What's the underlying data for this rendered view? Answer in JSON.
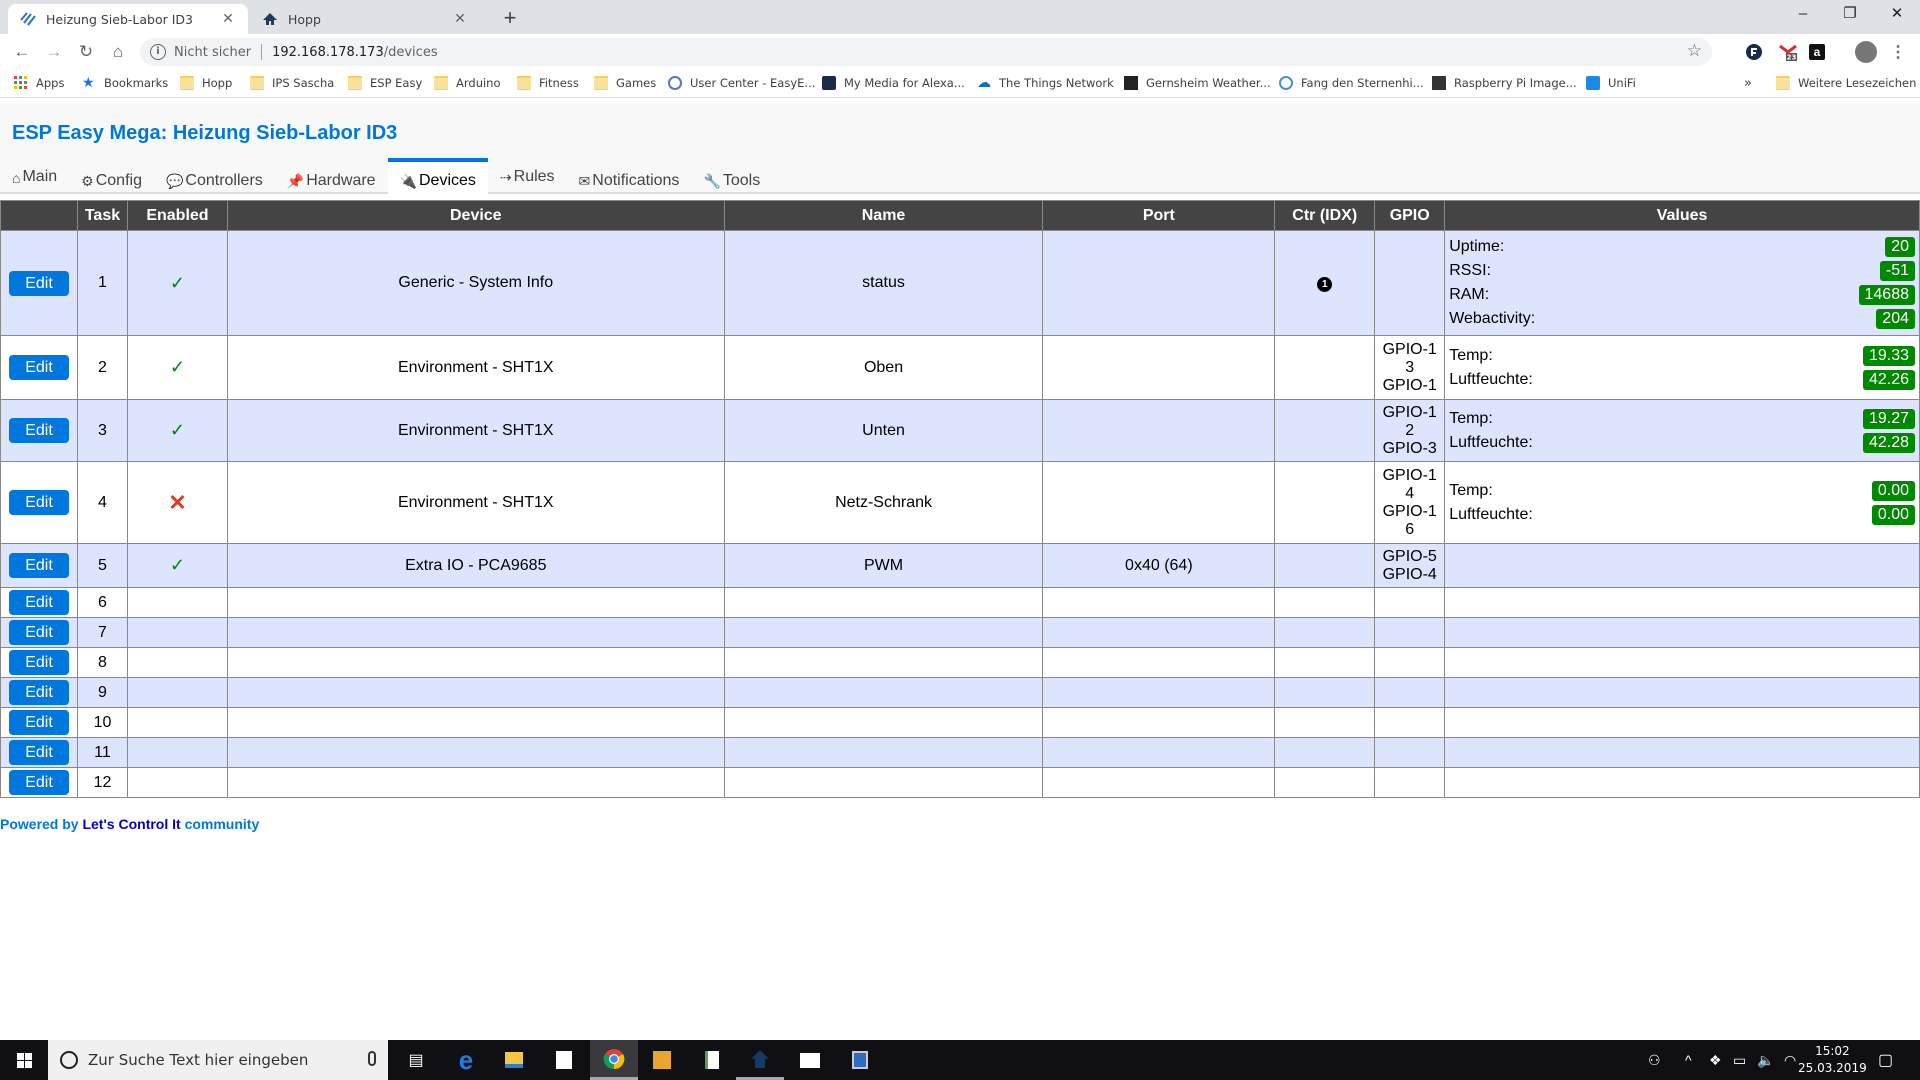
{
  "browser": {
    "tabs": [
      {
        "title": "Heizung Sieb-Labor ID3",
        "icon": "espeasy-icon",
        "active": true
      },
      {
        "title": "Hopp",
        "icon": "home-icon",
        "active": false
      }
    ],
    "new_tab": "+",
    "window_controls": {
      "minimize": "–",
      "maximize": "❐",
      "close": "✕"
    },
    "omnibox": {
      "security_label": "Nicht sicher",
      "host": "192.168.178.173",
      "path": "/devices"
    },
    "extensions": [
      {
        "name": "privacy-extension-icon"
      },
      {
        "name": "gmail-icon",
        "badge": "23"
      },
      {
        "name": "amazon-icon",
        "label": "a"
      }
    ],
    "bookmarks": [
      {
        "label": "Apps",
        "icon": "apps-grid-icon"
      },
      {
        "label": "Bookmarks",
        "icon": "star-icon"
      },
      {
        "label": "Hopp",
        "icon": "folder-icon"
      },
      {
        "label": "IPS Sascha",
        "icon": "folder-icon"
      },
      {
        "label": "ESP Easy",
        "icon": "folder-icon"
      },
      {
        "label": "Arduino",
        "icon": "folder-icon"
      },
      {
        "label": "Fitness",
        "icon": "folder-icon"
      },
      {
        "label": "Games",
        "icon": "folder-icon"
      },
      {
        "label": "User Center - EasyE...",
        "icon": "site-icon"
      },
      {
        "label": "My Media for Alexa...",
        "icon": "site-icon"
      },
      {
        "label": "The Things Network",
        "icon": "cloud-icon"
      },
      {
        "label": "Gernsheim Weather...",
        "icon": "site-icon"
      },
      {
        "label": "Fang den Sternenhi...",
        "icon": "site-icon"
      },
      {
        "label": "Raspberry Pi Image...",
        "icon": "site-icon"
      },
      {
        "label": "UniFi",
        "icon": "unifi-icon"
      }
    ],
    "bookmarks_overflow": "»",
    "other_bookmarks": "Weitere Lesezeichen"
  },
  "page": {
    "title": "ESP Easy Mega: Heizung Sieb-Labor ID3",
    "menu": [
      {
        "label": "Main",
        "icon": "⌂",
        "active": false
      },
      {
        "label": "Config",
        "icon": "⚙",
        "active": false
      },
      {
        "label": "Controllers",
        "icon": "💬",
        "active": false
      },
      {
        "label": "Hardware",
        "icon": "📌",
        "active": false
      },
      {
        "label": "Devices",
        "icon": "🔌",
        "active": true
      },
      {
        "label": "Rules",
        "icon": "⇢",
        "active": false
      },
      {
        "label": "Notifications",
        "icon": "✉",
        "active": false
      },
      {
        "label": "Tools",
        "icon": "🔧",
        "active": false
      }
    ],
    "table": {
      "headers": [
        "",
        "Task",
        "Enabled",
        "Device",
        "Name",
        "Port",
        "Ctr (IDX)",
        "GPIO",
        "Values"
      ],
      "edit_label": "Edit",
      "rows": [
        {
          "task": "1",
          "enabled": "yes",
          "device": "Generic - System Info",
          "name": "status",
          "port": "",
          "ctr": "1",
          "gpio": [],
          "values": [
            {
              "label": "Uptime:",
              "value": "20"
            },
            {
              "label": "RSSI:",
              "value": "-51"
            },
            {
              "label": "RAM:",
              "value": "14688"
            },
            {
              "label": "Webactivity:",
              "value": "204"
            }
          ]
        },
        {
          "task": "2",
          "enabled": "yes",
          "device": "Environment - SHT1X",
          "name": "Oben",
          "port": "",
          "ctr": "",
          "gpio": [
            "GPIO-13",
            "GPIO-1"
          ],
          "values": [
            {
              "label": "Temp:",
              "value": "19.33"
            },
            {
              "label": "Luftfeuchte:",
              "value": "42.26"
            }
          ]
        },
        {
          "task": "3",
          "enabled": "yes",
          "device": "Environment - SHT1X",
          "name": "Unten",
          "port": "",
          "ctr": "",
          "gpio": [
            "GPIO-12",
            "GPIO-3"
          ],
          "values": [
            {
              "label": "Temp:",
              "value": "19.27"
            },
            {
              "label": "Luftfeuchte:",
              "value": "42.28"
            }
          ]
        },
        {
          "task": "4",
          "enabled": "no",
          "device": "Environment - SHT1X",
          "name": "Netz-Schrank",
          "port": "",
          "ctr": "",
          "gpio": [
            "GPIO-14",
            "GPIO-16"
          ],
          "values": [
            {
              "label": "Temp:",
              "value": "0.00"
            },
            {
              "label": "Luftfeuchte:",
              "value": "0.00"
            }
          ]
        },
        {
          "task": "5",
          "enabled": "yes",
          "device": "Extra IO - PCA9685",
          "name": "PWM",
          "port": "0x40 (64)",
          "ctr": "",
          "gpio": [
            "GPIO-5",
            "GPIO-4"
          ],
          "values": []
        },
        {
          "task": "6",
          "enabled": "",
          "device": "",
          "name": "",
          "port": "",
          "ctr": "",
          "gpio": [],
          "values": []
        },
        {
          "task": "7",
          "enabled": "",
          "device": "",
          "name": "",
          "port": "",
          "ctr": "",
          "gpio": [],
          "values": []
        },
        {
          "task": "8",
          "enabled": "",
          "device": "",
          "name": "",
          "port": "",
          "ctr": "",
          "gpio": [],
          "values": []
        },
        {
          "task": "9",
          "enabled": "",
          "device": "",
          "name": "",
          "port": "",
          "ctr": "",
          "gpio": [],
          "values": []
        },
        {
          "task": "10",
          "enabled": "",
          "device": "",
          "name": "",
          "port": "",
          "ctr": "",
          "gpio": [],
          "values": []
        },
        {
          "task": "11",
          "enabled": "",
          "device": "",
          "name": "",
          "port": "",
          "ctr": "",
          "gpio": [],
          "values": []
        },
        {
          "task": "12",
          "enabled": "",
          "device": "",
          "name": "",
          "port": "",
          "ctr": "",
          "gpio": [],
          "values": []
        }
      ]
    },
    "footer": {
      "prefix": "Powered by ",
      "link": "Let's Control It",
      "suffix": " community"
    },
    "colors": {
      "accent": "#0077dd",
      "badge": "#008800",
      "header_bg": "#444444",
      "row_alt": "#dde4fd",
      "disabled": "#e03a20"
    }
  },
  "taskbar": {
    "search_placeholder": "Zur Suche Text hier eingeben",
    "apps": [
      "task-view-icon",
      "edge-icon",
      "file-explorer-icon",
      "store-icon",
      "chrome-icon",
      "notes-icon",
      "paint-icon",
      "home-app-icon",
      "mail-icon",
      "remote-desktop-icon"
    ],
    "time": "15:02",
    "date": "25.03.2019"
  }
}
